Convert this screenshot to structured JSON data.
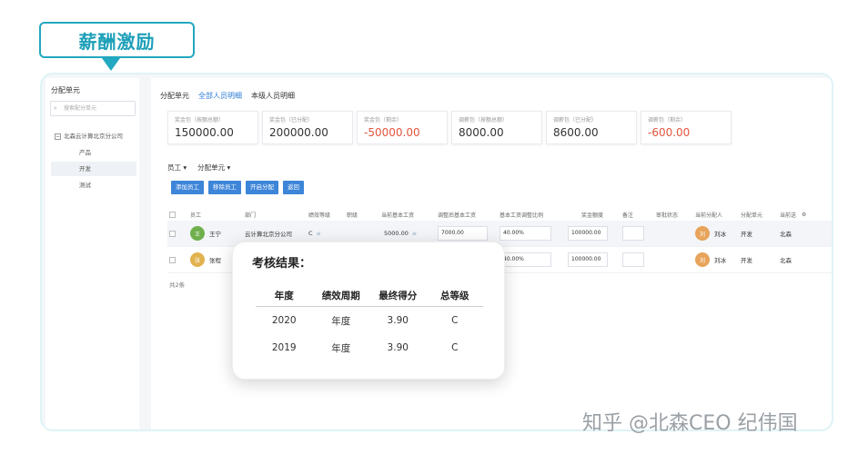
{
  "banner": {
    "title": "薪酬激励"
  },
  "sidebar": {
    "title": "分配单元",
    "search_placeholder": "搜索配分单元",
    "tree_root": "北森云计算北京分公司",
    "items": [
      {
        "label": "产品"
      },
      {
        "label": "开发"
      },
      {
        "label": "测试"
      }
    ]
  },
  "tabs": [
    {
      "label": "分配单元"
    },
    {
      "label": "全部人员明细"
    },
    {
      "label": "本级人员明细"
    }
  ],
  "cards": [
    {
      "label": "奖金包（按额总额）",
      "value": "150000.00"
    },
    {
      "label": "奖金包（已分配）",
      "value": "200000.00"
    },
    {
      "label": "奖金包（剩余）",
      "value": "-50000.00"
    },
    {
      "label": "调薪包（按额总额）",
      "value": "8000.00"
    },
    {
      "label": "调薪包（已分配）",
      "value": "8600.00"
    },
    {
      "label": "调薪包（剩余）",
      "value": "-600.00"
    }
  ],
  "filters": [
    {
      "label": "员工 ▾"
    },
    {
      "label": "分配单元 ▾"
    }
  ],
  "buttons": [
    {
      "label": "添加员工"
    },
    {
      "label": "移除员工"
    },
    {
      "label": "开启分配"
    },
    {
      "label": "返回"
    }
  ],
  "table": {
    "headers": [
      "员工",
      "部门",
      "绩效等级",
      "职级",
      "当前基本工资",
      "调整后基本工资",
      "基本工资调整比例",
      "奖金额度",
      "备注",
      "审批状态",
      "当前分配人",
      "分配单元",
      "当前送"
    ],
    "rows": [
      {
        "avatar": "王",
        "name": "王宁",
        "dept": "云计算北京分公司",
        "grade": "C",
        "salary": "5000.00",
        "adjusted": "7000.00",
        "ratio": "40.00%",
        "bonus": "100000.00",
        "assignee_avatar": "刘",
        "assignee": "刘冰",
        "unit": "开发",
        "dest": "北森"
      },
      {
        "avatar": "张",
        "name": "张程",
        "ratio": "40.00%",
        "bonus": "100000.00",
        "assignee_avatar": "刘",
        "assignee": "刘冰",
        "unit": "开发",
        "dest": "北森"
      }
    ],
    "total": "共2条"
  },
  "popup": {
    "title": "考核结果：",
    "headers": [
      "年度",
      "绩效周期",
      "最终得分",
      "总等级"
    ],
    "rows": [
      [
        "2020",
        "年度",
        "3.90",
        "C"
      ],
      [
        "2019",
        "年度",
        "3.90",
        "C"
      ]
    ]
  },
  "watermark": "知乎 @北森CEO 纪伟国"
}
